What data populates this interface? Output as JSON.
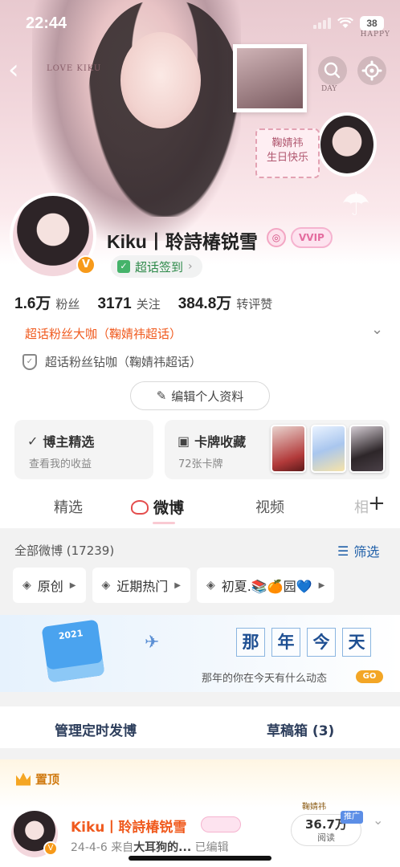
{
  "status_bar": {
    "time": "22:44",
    "battery": "38"
  },
  "banner": {
    "love_text": "LOVE KIKU",
    "happy_text": "HAPPY",
    "day_text": "DAY",
    "card_line1": "鞠婧祎",
    "card_line2": "生日快乐"
  },
  "profile": {
    "username": "Kiku丨聆詩椿锐雪",
    "vip_badge": "VVIP",
    "checkin_label": "超话签到",
    "stats": [
      {
        "value": "1.6万",
        "label": "粉丝"
      },
      {
        "value": "3171",
        "label": "关注"
      },
      {
        "value": "384.8万",
        "label": "转评赞"
      }
    ],
    "super_fan": "超话粉丝大咖（鞠婧祎超话）",
    "diamond_fan": "超话粉丝钻咖（鞠婧祎超话）",
    "edit_profile": "编辑个人资料"
  },
  "cards": {
    "featured_title": "博主精选",
    "featured_sub": "查看我的收益",
    "collection_title": "卡牌收藏",
    "collection_sub": "72张卡牌"
  },
  "tabs": [
    "精选",
    "微博",
    "视频",
    "相"
  ],
  "feed": {
    "all_weibo": "全部微博 (17239)",
    "filter_label": "筛选",
    "chips": [
      "原创",
      "近期热门",
      "初夏.📚🍊园💙"
    ]
  },
  "memory": {
    "title_chars": [
      "那",
      "年",
      "今",
      "天"
    ],
    "subtitle": "那年的你在今天有什么动态",
    "go_label": "GO"
  },
  "manage": {
    "scheduled": "管理定时发博",
    "drafts": "草稿箱 (3)"
  },
  "pinned": {
    "label": "置顶",
    "author": "Kiku丨聆詩椿锐雪",
    "date": "24-4-6",
    "source_prefix": "来自",
    "source": "大耳狗的...",
    "edited": "已编辑",
    "views": "36.7万",
    "views_label": "阅读",
    "ad_tag": "推广",
    "corner_tag": "鞠婧祎"
  },
  "colors": {
    "accent_orange": "#f05a1e",
    "link_blue": "#1f5fa8",
    "verified": "#f79a1a"
  }
}
